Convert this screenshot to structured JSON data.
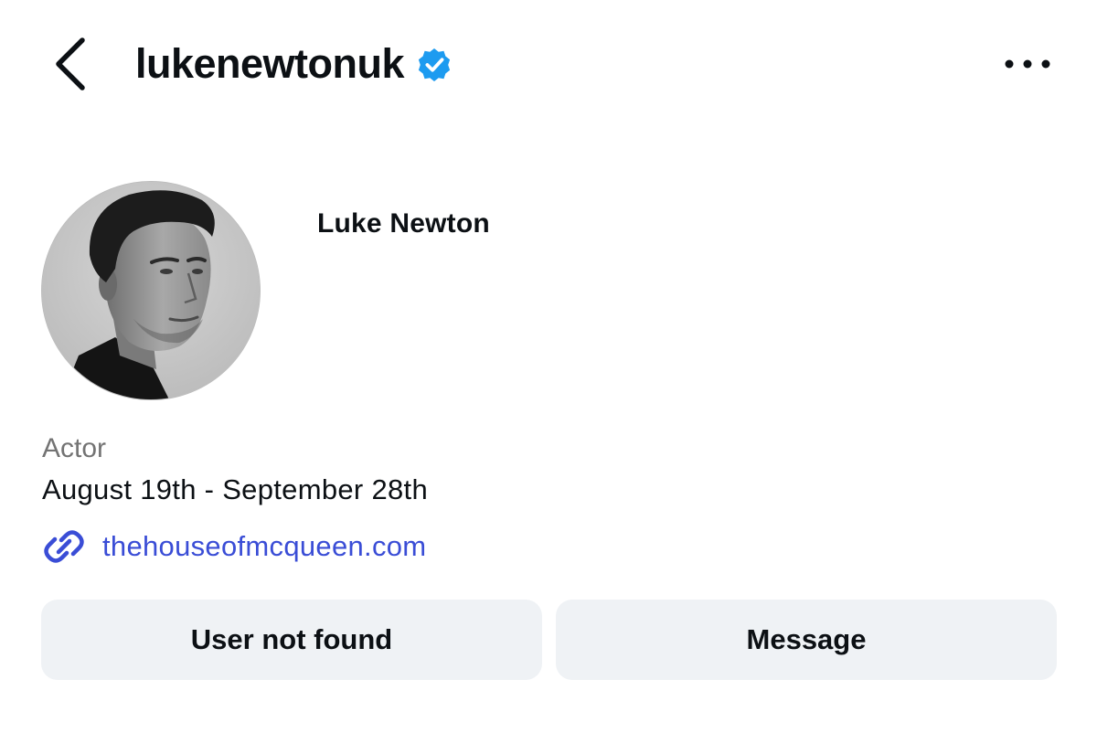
{
  "header": {
    "username": "lukenewtonuk",
    "verified_color": "#1d9bf0",
    "back_icon": "chevron-left-icon",
    "more_icon": "more-horizontal-icon"
  },
  "profile": {
    "full_name": "Luke Newton",
    "category": "Actor",
    "bio": "August 19th - September 28th",
    "link": "thehouseofmcqueen.com",
    "link_color": "#3a4dd6"
  },
  "actions": {
    "primary_label": "User not found",
    "message_label": "Message"
  }
}
